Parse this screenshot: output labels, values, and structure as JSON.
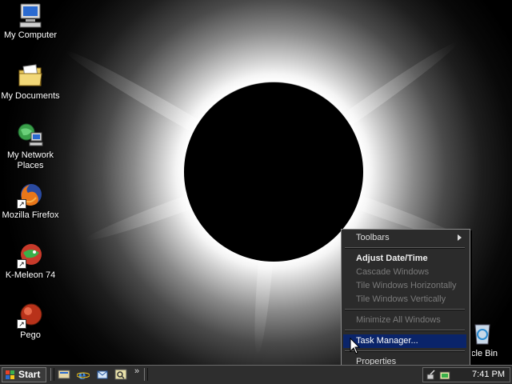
{
  "desktop": {
    "icons": [
      {
        "label": "My Computer",
        "icon": "computer-icon"
      },
      {
        "label": "My Documents",
        "icon": "folder-icon"
      },
      {
        "label": "My Network Places",
        "icon": "network-icon"
      },
      {
        "label": "Mozilla Firefox",
        "icon": "firefox-icon"
      },
      {
        "label": "K-Meleon 74",
        "icon": "kmeleon-icon"
      },
      {
        "label": "Pego",
        "icon": "pego-icon"
      },
      {
        "label": "cycle Bin",
        "icon": "recycle-bin-icon"
      }
    ]
  },
  "context_menu": {
    "items": [
      {
        "label": "Toolbars",
        "state": "normal",
        "submenu": true
      },
      {
        "label": "Adjust Date/Time",
        "state": "bold"
      },
      {
        "label": "Cascade Windows",
        "state": "disabled"
      },
      {
        "label": "Tile Windows Horizontally",
        "state": "disabled"
      },
      {
        "label": "Tile Windows Vertically",
        "state": "disabled"
      },
      {
        "label": "Minimize All Windows",
        "state": "disabled"
      },
      {
        "label": "Task Manager...",
        "state": "highlighted"
      },
      {
        "label": "Properties",
        "state": "normal"
      }
    ]
  },
  "taskbar": {
    "start_label": "Start",
    "quick_launch": [
      "show-desktop-icon",
      "internet-explorer-icon",
      "outlook-icon",
      "search-icon"
    ],
    "overflow_label": "»",
    "clock": "7:41 PM"
  },
  "colors": {
    "taskbar": "#2e2e2e",
    "menu_background": "#2b2b2b",
    "menu_highlight": "#0a246a"
  }
}
